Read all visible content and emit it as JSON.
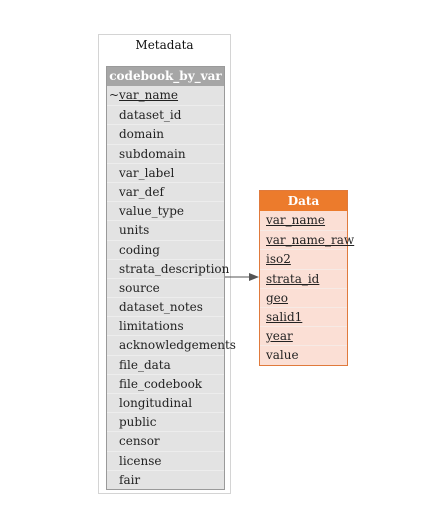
{
  "cluster": {
    "title": "Metadata"
  },
  "tables": {
    "codebook": {
      "title": "codebook_by_var",
      "fields": [
        {
          "name": "var_name",
          "key": true,
          "marker": "~"
        },
        {
          "name": "dataset_id",
          "key": false,
          "marker": ""
        },
        {
          "name": "domain",
          "key": false,
          "marker": ""
        },
        {
          "name": "subdomain",
          "key": false,
          "marker": ""
        },
        {
          "name": "var_label",
          "key": false,
          "marker": ""
        },
        {
          "name": "var_def",
          "key": false,
          "marker": ""
        },
        {
          "name": "value_type",
          "key": false,
          "marker": ""
        },
        {
          "name": "units",
          "key": false,
          "marker": ""
        },
        {
          "name": "coding",
          "key": false,
          "marker": ""
        },
        {
          "name": "strata_description",
          "key": false,
          "marker": ""
        },
        {
          "name": "source",
          "key": false,
          "marker": ""
        },
        {
          "name": "dataset_notes",
          "key": false,
          "marker": ""
        },
        {
          "name": "limitations",
          "key": false,
          "marker": ""
        },
        {
          "name": "acknowledgements",
          "key": false,
          "marker": ""
        },
        {
          "name": "file_data",
          "key": false,
          "marker": ""
        },
        {
          "name": "file_codebook",
          "key": false,
          "marker": ""
        },
        {
          "name": "longitudinal",
          "key": false,
          "marker": ""
        },
        {
          "name": "public",
          "key": false,
          "marker": ""
        },
        {
          "name": "censor",
          "key": false,
          "marker": ""
        },
        {
          "name": "license",
          "key": false,
          "marker": ""
        },
        {
          "name": "fair",
          "key": false,
          "marker": ""
        }
      ]
    },
    "data": {
      "title": "Data",
      "fields": [
        {
          "name": "var_name",
          "key": true,
          "marker": ""
        },
        {
          "name": "var_name_raw",
          "key": true,
          "marker": ""
        },
        {
          "name": "iso2",
          "key": true,
          "marker": ""
        },
        {
          "name": "strata_id",
          "key": true,
          "marker": ""
        },
        {
          "name": "geo",
          "key": true,
          "marker": ""
        },
        {
          "name": "salid1",
          "key": true,
          "marker": ""
        },
        {
          "name": "year",
          "key": true,
          "marker": ""
        },
        {
          "name": "value",
          "key": false,
          "marker": ""
        }
      ]
    }
  },
  "relationships": [
    {
      "from": "codebook_by_var",
      "to": "Data"
    }
  ],
  "colors": {
    "codebook_header": "#a6a6a6",
    "codebook_body": "#e3e3e3",
    "data_header": "#ec7b2c",
    "data_body": "#fbdfd5",
    "edge": "#555555"
  }
}
